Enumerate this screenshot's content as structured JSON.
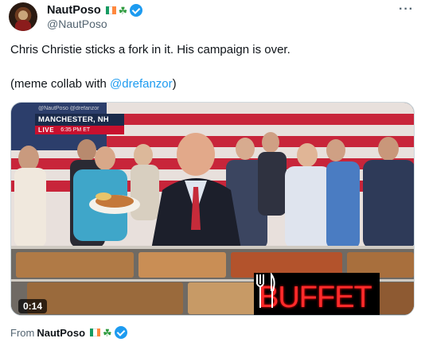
{
  "author": {
    "display_name": "NautPoso",
    "handle": "@NautPoso",
    "flag_colors": [
      "#169b62",
      "#ffffff",
      "#ff883e"
    ],
    "clover": "☘"
  },
  "tweet": {
    "text": "Chris Christie sticks a fork in it. His campaign is over.",
    "collab_prefix": "(meme collab with ",
    "collab_mention": "@drefanzor",
    "collab_suffix": ")"
  },
  "video": {
    "watermark": "@NautPoso @drefanzor",
    "location": "MANCHESTER, NH",
    "live_label": "LIVE",
    "live_time": "6:35 PM ET",
    "overlay_text": "BUFFET",
    "duration": "0:14"
  },
  "footer": {
    "from_label": "From",
    "from_name": "NautPoso"
  },
  "colors": {
    "accent": "#1d9bf0",
    "verified": "#1d9bf0",
    "neon_red": "#ff2b2b"
  },
  "icons": {
    "more": "more-options-icon",
    "verified": "verified-badge-icon",
    "fork_knife": "fork-knife-icon"
  }
}
